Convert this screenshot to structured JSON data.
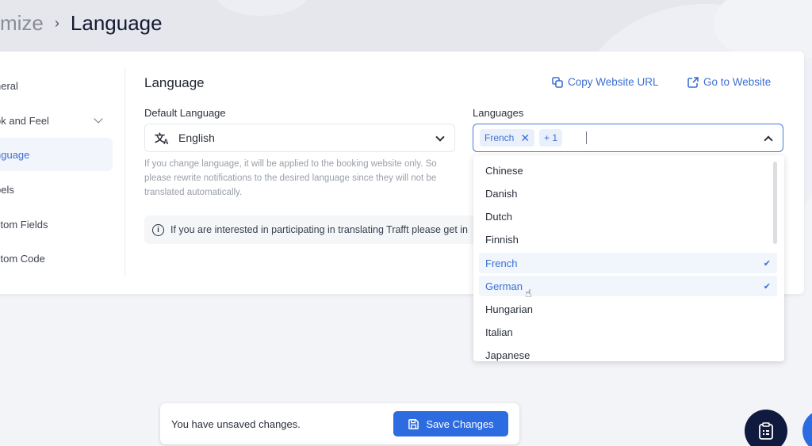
{
  "breadcrumb": {
    "previous": "mize",
    "separator": "›",
    "current": "Language"
  },
  "sidebar": {
    "items": [
      {
        "label": "neral",
        "active": false
      },
      {
        "label": "ok and Feel",
        "active": false,
        "has_chevron": true
      },
      {
        "label": "nguage",
        "active": true
      },
      {
        "label": "bels",
        "active": false
      },
      {
        "label": "stom Fields",
        "active": false
      },
      {
        "label": "stom Code",
        "active": false
      }
    ]
  },
  "main": {
    "title": "Language",
    "copy_url_label": "Copy Website URL",
    "go_to_website_label": "Go to Website",
    "default_language": {
      "label": "Default Language",
      "value": "English",
      "icon": "translate-icon",
      "helper": "If you change language, it will be applied to the booking website only. So please rewrite notifications to the desired language since they will not be translated automatically."
    },
    "info": "If you are interested in participating in translating Trafft please get in",
    "languages": {
      "label": "Languages",
      "chips": [
        "French"
      ],
      "more_count": "+ 1",
      "options": [
        {
          "label": "Chinese",
          "selected": false
        },
        {
          "label": "Danish",
          "selected": false
        },
        {
          "label": "Dutch",
          "selected": false
        },
        {
          "label": "Finnish",
          "selected": false
        },
        {
          "label": "French",
          "selected": true
        },
        {
          "label": "German",
          "selected": true
        },
        {
          "label": "Hungarian",
          "selected": false
        },
        {
          "label": "Italian",
          "selected": false
        },
        {
          "label": "Japanese",
          "selected": false
        }
      ]
    }
  },
  "save_bar": {
    "message": "You have unsaved changes.",
    "button_label": "Save Changes"
  },
  "colors": {
    "accent": "#2d6be0",
    "link": "#3b6fd4",
    "fab_dark": "#0f1a3e"
  }
}
